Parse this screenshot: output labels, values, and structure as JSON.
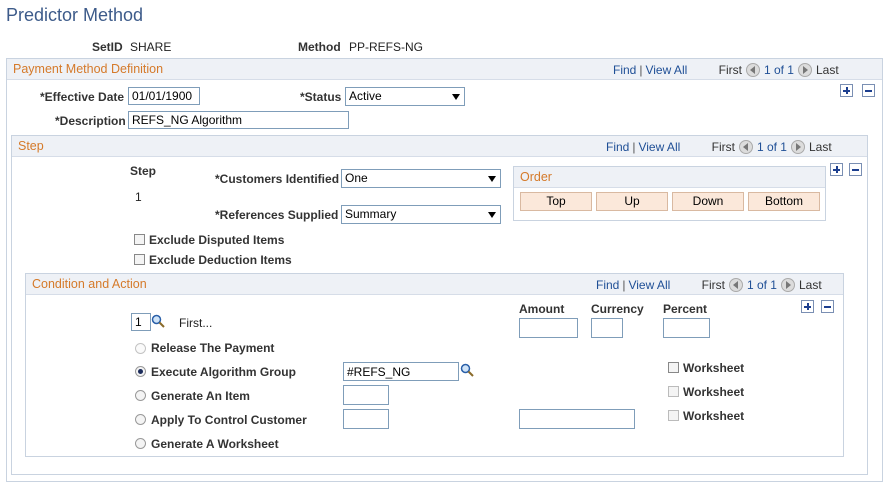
{
  "page": {
    "title": "Predictor Method"
  },
  "header": {
    "setid_label": "SetID",
    "setid_value": "SHARE",
    "method_label": "Method",
    "method_value": "PP-REFS-NG"
  },
  "nav": {
    "find": "Find",
    "sep": "|",
    "viewall": "View All",
    "first": "First",
    "count": "1 of 1",
    "last": "Last"
  },
  "definition": {
    "title": "Payment Method Definition",
    "effdate_label": "*Effective Date",
    "effdate_value": "01/01/1900",
    "status_label": "*Status",
    "status_value": "Active",
    "desc_label": "*Description",
    "desc_value": "REFS_NG Algorithm"
  },
  "step": {
    "title": "Step",
    "step_label": "Step",
    "step_value": "1",
    "cust_label": "*Customers Identified",
    "cust_value": "One",
    "refs_label": "*References Supplied",
    "refs_value": "Summary",
    "order_title": "Order",
    "order_buttons": [
      "Top",
      "Up",
      "Down",
      "Bottom"
    ],
    "exclude_disputed": "Exclude Disputed Items",
    "exclude_deduction": "Exclude Deduction Items"
  },
  "condition": {
    "title": "Condition and Action",
    "seq_value": "1",
    "first_text": "First...",
    "amount_label": "Amount",
    "currency_label": "Currency",
    "percent_label": "Percent",
    "release": "Release The Payment",
    "execute": "Execute Algorithm Group",
    "execute_value": "#REFS_NG",
    "generate_item": "Generate An Item",
    "apply_control": "Apply To Control Customer",
    "generate_worksheet": "Generate A Worksheet",
    "worksheet": "Worksheet"
  },
  "colors": {
    "title": "#3d5b8a",
    "section_title": "#d57a2a",
    "link": "#1f4f96",
    "button_bg": "#fbe8da"
  }
}
